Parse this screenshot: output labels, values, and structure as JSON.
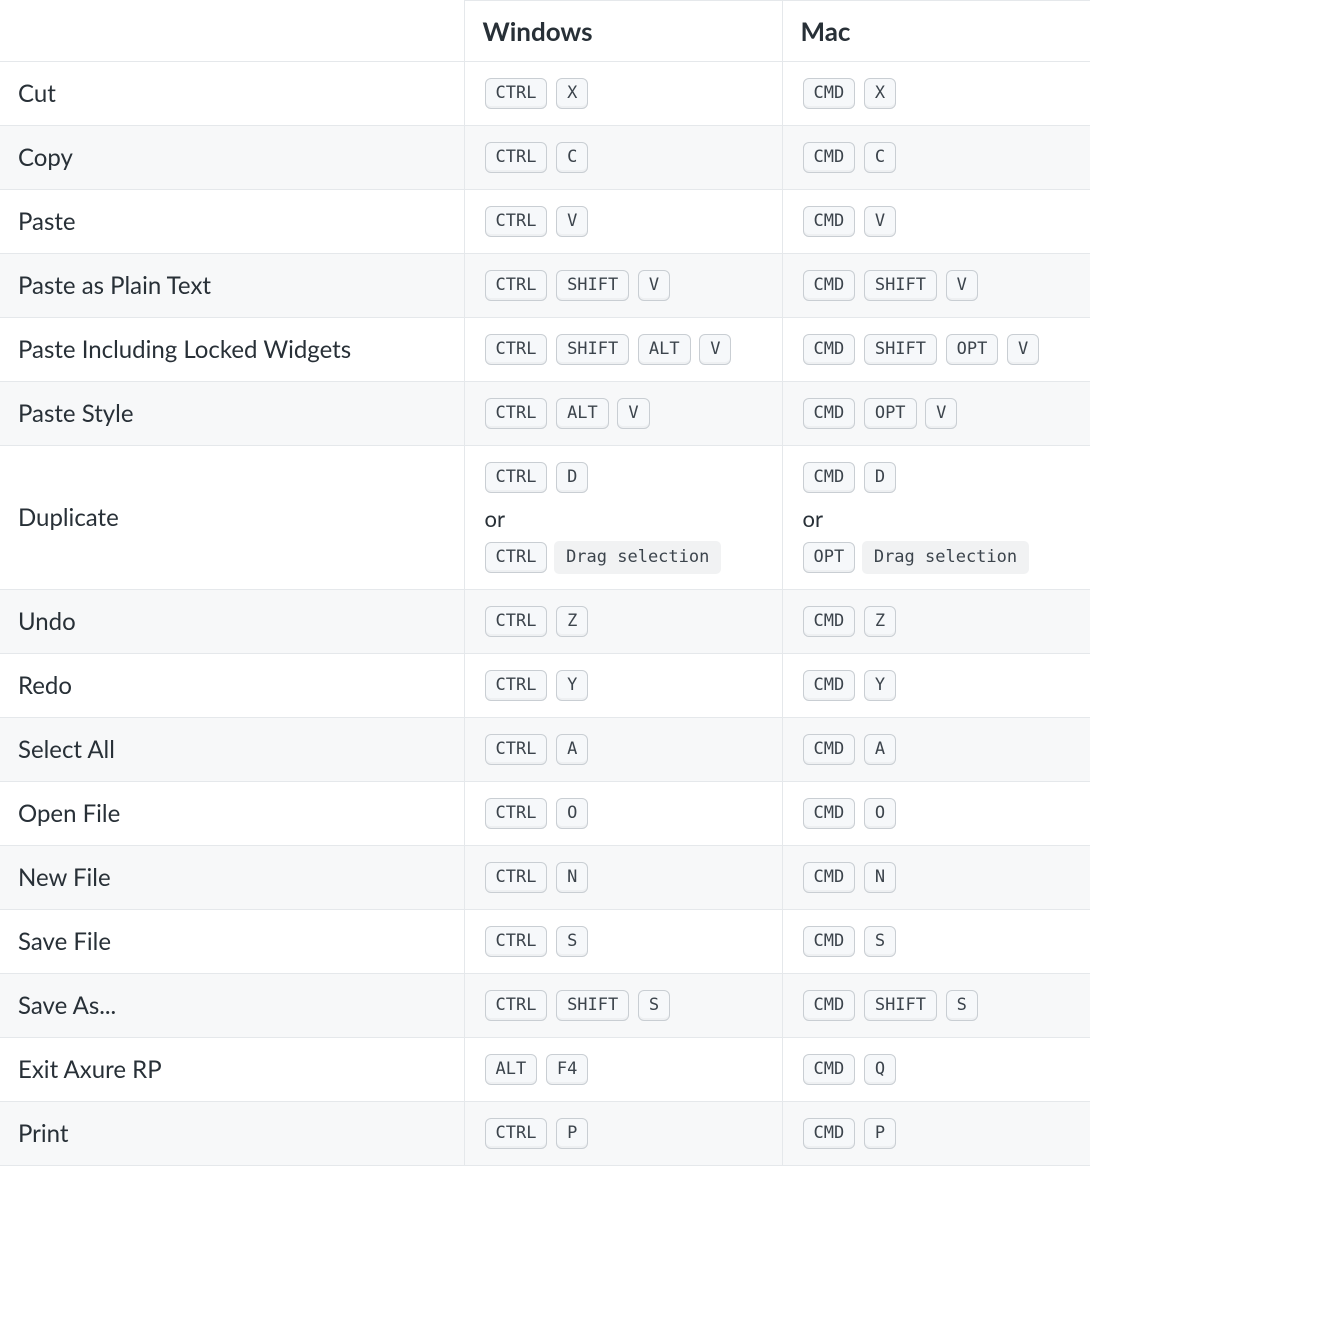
{
  "columns": {
    "action": "",
    "windows": "Windows",
    "mac": "Mac"
  },
  "or_text": "or",
  "rows": [
    {
      "action": "Cut",
      "windows": [
        [
          {
            "t": "key",
            "v": "CTRL"
          },
          {
            "t": "key",
            "v": "X"
          }
        ]
      ],
      "mac": [
        [
          {
            "t": "key",
            "v": "CMD"
          },
          {
            "t": "key",
            "v": "X"
          }
        ]
      ]
    },
    {
      "action": "Copy",
      "windows": [
        [
          {
            "t": "key",
            "v": "CTRL"
          },
          {
            "t": "key",
            "v": "C"
          }
        ]
      ],
      "mac": [
        [
          {
            "t": "key",
            "v": "CMD"
          },
          {
            "t": "key",
            "v": "C"
          }
        ]
      ]
    },
    {
      "action": "Paste",
      "windows": [
        [
          {
            "t": "key",
            "v": "CTRL"
          },
          {
            "t": "key",
            "v": "V"
          }
        ]
      ],
      "mac": [
        [
          {
            "t": "key",
            "v": "CMD"
          },
          {
            "t": "key",
            "v": "V"
          }
        ]
      ]
    },
    {
      "action": "Paste as Plain Text",
      "windows": [
        [
          {
            "t": "key",
            "v": "CTRL"
          },
          {
            "t": "key",
            "v": "SHIFT"
          },
          {
            "t": "key",
            "v": "V"
          }
        ]
      ],
      "mac": [
        [
          {
            "t": "key",
            "v": "CMD"
          },
          {
            "t": "key",
            "v": "SHIFT"
          },
          {
            "t": "key",
            "v": "V"
          }
        ]
      ]
    },
    {
      "action": "Paste Including Locked Widgets",
      "windows": [
        [
          {
            "t": "key",
            "v": "CTRL"
          },
          {
            "t": "key",
            "v": "SHIFT"
          },
          {
            "t": "key",
            "v": "ALT"
          },
          {
            "t": "key",
            "v": "V"
          }
        ]
      ],
      "mac": [
        [
          {
            "t": "key",
            "v": "CMD"
          },
          {
            "t": "key",
            "v": "SHIFT"
          },
          {
            "t": "key",
            "v": "OPT"
          },
          {
            "t": "key",
            "v": "V"
          }
        ]
      ]
    },
    {
      "action": "Paste Style",
      "windows": [
        [
          {
            "t": "key",
            "v": "CTRL"
          },
          {
            "t": "key",
            "v": "ALT"
          },
          {
            "t": "key",
            "v": "V"
          }
        ]
      ],
      "mac": [
        [
          {
            "t": "key",
            "v": "CMD"
          },
          {
            "t": "key",
            "v": "OPT"
          },
          {
            "t": "key",
            "v": "V"
          }
        ]
      ]
    },
    {
      "action": "Duplicate",
      "windows": [
        [
          {
            "t": "key",
            "v": "CTRL"
          },
          {
            "t": "key",
            "v": "D"
          }
        ],
        [
          {
            "t": "key",
            "v": "CTRL"
          },
          {
            "t": "hint",
            "v": "Drag selection"
          }
        ]
      ],
      "mac": [
        [
          {
            "t": "key",
            "v": "CMD"
          },
          {
            "t": "key",
            "v": "D"
          }
        ],
        [
          {
            "t": "key",
            "v": "OPT"
          },
          {
            "t": "hint",
            "v": "Drag selection"
          }
        ]
      ]
    },
    {
      "action": "Undo",
      "windows": [
        [
          {
            "t": "key",
            "v": "CTRL"
          },
          {
            "t": "key",
            "v": "Z"
          }
        ]
      ],
      "mac": [
        [
          {
            "t": "key",
            "v": "CMD"
          },
          {
            "t": "key",
            "v": "Z"
          }
        ]
      ]
    },
    {
      "action": "Redo",
      "windows": [
        [
          {
            "t": "key",
            "v": "CTRL"
          },
          {
            "t": "key",
            "v": "Y"
          }
        ]
      ],
      "mac": [
        [
          {
            "t": "key",
            "v": "CMD"
          },
          {
            "t": "key",
            "v": "Y"
          }
        ]
      ]
    },
    {
      "action": "Select All",
      "windows": [
        [
          {
            "t": "key",
            "v": "CTRL"
          },
          {
            "t": "key",
            "v": "A"
          }
        ]
      ],
      "mac": [
        [
          {
            "t": "key",
            "v": "CMD"
          },
          {
            "t": "key",
            "v": "A"
          }
        ]
      ]
    },
    {
      "action": "Open File",
      "windows": [
        [
          {
            "t": "key",
            "v": "CTRL"
          },
          {
            "t": "key",
            "v": "O"
          }
        ]
      ],
      "mac": [
        [
          {
            "t": "key",
            "v": "CMD"
          },
          {
            "t": "key",
            "v": "O"
          }
        ]
      ]
    },
    {
      "action": "New File",
      "windows": [
        [
          {
            "t": "key",
            "v": "CTRL"
          },
          {
            "t": "key",
            "v": "N"
          }
        ]
      ],
      "mac": [
        [
          {
            "t": "key",
            "v": "CMD"
          },
          {
            "t": "key",
            "v": "N"
          }
        ]
      ]
    },
    {
      "action": "Save File",
      "windows": [
        [
          {
            "t": "key",
            "v": "CTRL"
          },
          {
            "t": "key",
            "v": "S"
          }
        ]
      ],
      "mac": [
        [
          {
            "t": "key",
            "v": "CMD"
          },
          {
            "t": "key",
            "v": "S"
          }
        ]
      ]
    },
    {
      "action": "Save As...",
      "windows": [
        [
          {
            "t": "key",
            "v": "CTRL"
          },
          {
            "t": "key",
            "v": "SHIFT"
          },
          {
            "t": "key",
            "v": "S"
          }
        ]
      ],
      "mac": [
        [
          {
            "t": "key",
            "v": "CMD"
          },
          {
            "t": "key",
            "v": "SHIFT"
          },
          {
            "t": "key",
            "v": "S"
          }
        ]
      ]
    },
    {
      "action": "Exit Axure RP",
      "windows": [
        [
          {
            "t": "key",
            "v": "ALT"
          },
          {
            "t": "key",
            "v": "F4"
          }
        ]
      ],
      "mac": [
        [
          {
            "t": "key",
            "v": "CMD"
          },
          {
            "t": "key",
            "v": "Q"
          }
        ]
      ]
    },
    {
      "action": "Print",
      "windows": [
        [
          {
            "t": "key",
            "v": "CTRL"
          },
          {
            "t": "key",
            "v": "P"
          }
        ]
      ],
      "mac": [
        [
          {
            "t": "key",
            "v": "CMD"
          },
          {
            "t": "key",
            "v": "P"
          }
        ]
      ]
    }
  ]
}
